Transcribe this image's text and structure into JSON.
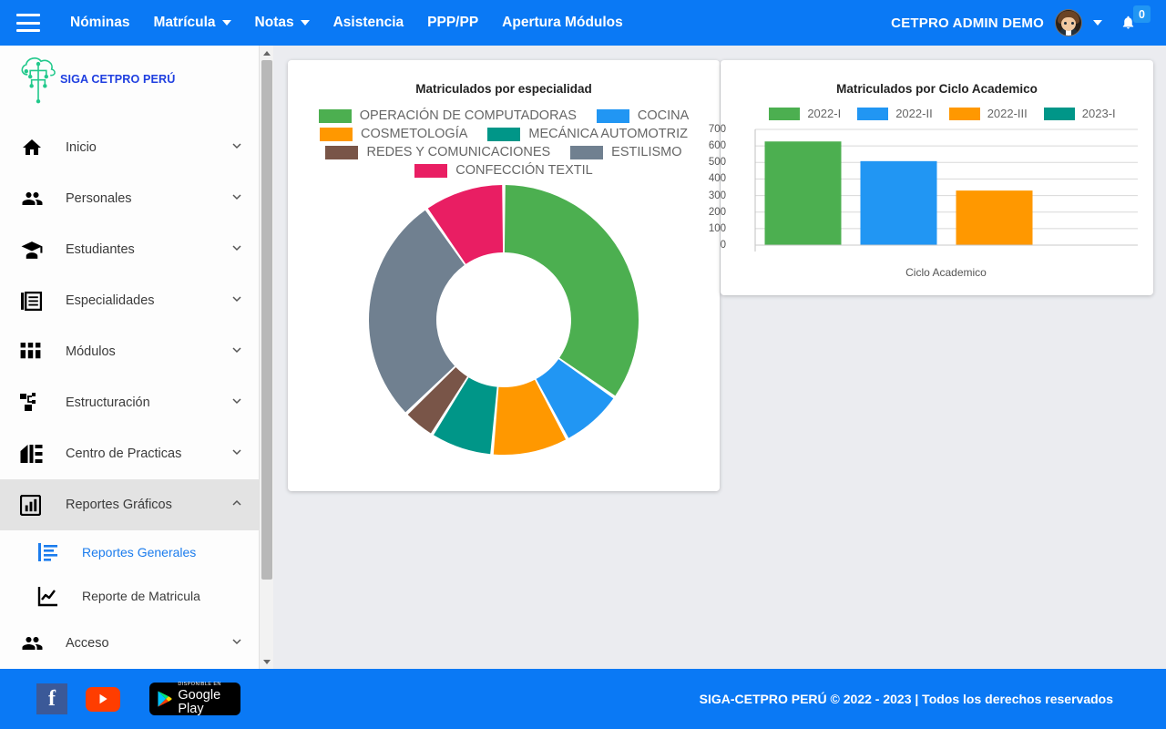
{
  "navbar": {
    "menu_icon": "hamburger-icon",
    "items": [
      {
        "label": "Nóminas",
        "has_caret": false
      },
      {
        "label": "Matrícula",
        "has_caret": true
      },
      {
        "label": "Notas",
        "has_caret": true
      },
      {
        "label": "Asistencia",
        "has_caret": false
      },
      {
        "label": "PPP/PP",
        "has_caret": false
      },
      {
        "label": "Apertura Módulos",
        "has_caret": false
      }
    ],
    "user_name": "CETPRO ADMIN DEMO",
    "notification_count": "0",
    "background_color": "#0a79f5"
  },
  "sidebar": {
    "brand": "SIGA CETPRO PERÚ",
    "brand_color": "#1f3fe0",
    "items": [
      {
        "label": "Inicio",
        "icon": "home-icon",
        "expanded": false
      },
      {
        "label": "Personales",
        "icon": "people-icon",
        "expanded": false
      },
      {
        "label": "Estudiantes",
        "icon": "graduate-icon",
        "expanded": false
      },
      {
        "label": "Especialidades",
        "icon": "book-icon",
        "expanded": false
      },
      {
        "label": "Módulos",
        "icon": "grid-icon",
        "expanded": false
      },
      {
        "label": "Estructuración",
        "icon": "sitemap-icon",
        "expanded": false
      },
      {
        "label": "Centro de Practicas",
        "icon": "building-icon",
        "expanded": false
      },
      {
        "label": "Reportes Gráficos",
        "icon": "bar-chart-icon",
        "expanded": true
      },
      {
        "label": "Acceso",
        "icon": "people-icon",
        "expanded": false
      }
    ],
    "submenu": [
      {
        "label": "Reportes Generales",
        "icon": "report-list-icon",
        "selected": true
      },
      {
        "label": "Reporte de Matricula",
        "icon": "line-chart-icon",
        "selected": false
      }
    ]
  },
  "chart_data": [
    {
      "type": "pie",
      "variant": "donut",
      "title": "Matriculados por especialidad",
      "legend_position": "top",
      "categories": [
        "OPERACIÓN DE COMPUTADORAS",
        "COCINA",
        "COSMETOLOGÍA",
        "MECÁNICA AUTOMOTRIZ",
        "REDES Y COMUNICACIONES",
        "ESTILISMO",
        "CONFECCIÓN TEXTIL"
      ],
      "values": [
        34.7,
        7.5,
        9.2,
        7.5,
        3.9,
        27.5,
        9.7
      ],
      "colors": [
        "#4caf50",
        "#2196f3",
        "#ff9800",
        "#009688",
        "#795548",
        "#708090",
        "#e91e63"
      ],
      "start_angle": 0,
      "inner_radius_ratio": 0.5
    },
    {
      "type": "bar",
      "title": "Matriculados por Ciclo Academico",
      "legend_position": "top",
      "categories": [
        "2022-I",
        "2022-II",
        "2022-III",
        "2023-I"
      ],
      "values": [
        627,
        508,
        330,
        0
      ],
      "colors": [
        "#4caf50",
        "#2196f3",
        "#ff9800",
        "#009688"
      ],
      "xlabel": "Ciclo Academico",
      "ylabel": "",
      "ylim": [
        0,
        700
      ],
      "yticks": [
        700,
        600,
        500,
        400,
        300,
        200,
        100,
        0
      ],
      "grid": true
    }
  ],
  "footer": {
    "facebook_label": "f",
    "youtube_label": "youtube-icon",
    "googleplay_small": "DISPONIBLE EN",
    "googleplay_big": "Google Play",
    "copyright": "SIGA-CETPRO PERÚ © 2022 - 2023 | Todos los derechos reservados"
  }
}
